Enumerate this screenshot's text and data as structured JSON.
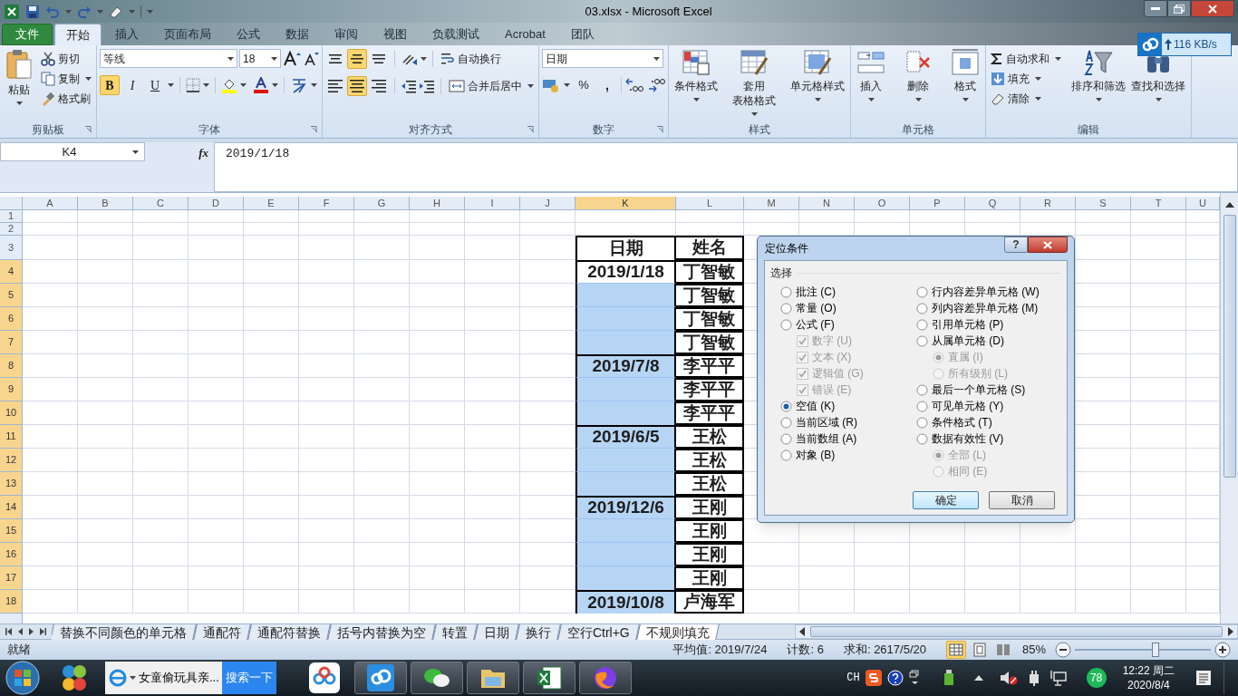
{
  "window": {
    "title": "03.xlsx  -  Microsoft Excel"
  },
  "ribbon_tabs": [
    {
      "label": "文件",
      "kind": "file",
      "selected": false
    },
    {
      "label": "开始",
      "kind": "tab",
      "selected": true
    },
    {
      "label": "插入",
      "kind": "tab",
      "selected": false
    },
    {
      "label": "页面布局",
      "kind": "tab",
      "selected": false
    },
    {
      "label": "公式",
      "kind": "tab",
      "selected": false
    },
    {
      "label": "数据",
      "kind": "tab",
      "selected": false
    },
    {
      "label": "审阅",
      "kind": "tab",
      "selected": false
    },
    {
      "label": "视图",
      "kind": "tab",
      "selected": false
    },
    {
      "label": "负载测试",
      "kind": "tab",
      "selected": false
    },
    {
      "label": "Acrobat",
      "kind": "tab",
      "selected": false
    },
    {
      "label": "团队",
      "kind": "tab",
      "selected": false
    }
  ],
  "upload_widget": {
    "speed": "116 KB/s"
  },
  "ribbon": {
    "clipboard": {
      "title": "剪贴板",
      "paste": "粘贴",
      "cut": "剪切",
      "copy": "复制",
      "format_painter": "格式刷"
    },
    "font": {
      "title": "字体",
      "font_name": "等线",
      "font_size": "18",
      "toggles": [
        {
          "label": "B",
          "on": true
        },
        {
          "label": "I",
          "on": false
        },
        {
          "label": "U",
          "on": false
        }
      ]
    },
    "alignment": {
      "title": "对齐方式",
      "vertical": [
        {
          "on": false
        },
        {
          "on": true
        },
        {
          "on": false
        }
      ],
      "horizontal": [
        {
          "on": false
        },
        {
          "on": true
        },
        {
          "on": false
        }
      ],
      "wrap_text": "自动换行",
      "merge_center": "合并后居中"
    },
    "number": {
      "title": "数字",
      "format": "日期",
      "percent": "%",
      "comma": ","
    },
    "styles": {
      "title": "样式",
      "buttons": [
        {
          "lines": [
            "条件格式"
          ]
        },
        {
          "lines": [
            "套用",
            "表格格式"
          ]
        },
        {
          "lines": [
            "单元格样式"
          ]
        }
      ]
    },
    "cells": {
      "title": "单元格",
      "buttons": [
        {
          "lines": [
            "插入"
          ]
        },
        {
          "lines": [
            "删除"
          ]
        },
        {
          "lines": [
            "格式"
          ]
        }
      ]
    },
    "editing": {
      "title": "编辑",
      "autosum": "自动求和",
      "fill": "填充",
      "clear": "清除",
      "sort_filter": "排序和筛选",
      "find_select": "查找和选择"
    }
  },
  "formula_bar": {
    "name_box": "K4",
    "fx": "fx",
    "value": "2019/1/18"
  },
  "sheet": {
    "columns": [
      {
        "label": "A",
        "selected": false
      },
      {
        "label": "B",
        "selected": false
      },
      {
        "label": "C",
        "selected": false
      },
      {
        "label": "D",
        "selected": false
      },
      {
        "label": "E",
        "selected": false
      },
      {
        "label": "F",
        "selected": false
      },
      {
        "label": "G",
        "selected": false
      },
      {
        "label": "H",
        "selected": false
      },
      {
        "label": "I",
        "selected": false
      },
      {
        "label": "J",
        "selected": false
      },
      {
        "label": "K",
        "selected": true
      },
      {
        "label": "L",
        "selected": false
      },
      {
        "label": "M",
        "selected": false
      },
      {
        "label": "N",
        "selected": false
      },
      {
        "label": "O",
        "selected": false
      },
      {
        "label": "P",
        "selected": false
      },
      {
        "label": "Q",
        "selected": false
      },
      {
        "label": "R",
        "selected": false
      },
      {
        "label": "S",
        "selected": false
      },
      {
        "label": "T",
        "selected": false
      },
      {
        "label": "U",
        "selected": false
      }
    ],
    "rows": [
      {
        "number": "1",
        "selected": false
      },
      {
        "number": "2",
        "selected": false
      },
      {
        "number": "3",
        "selected": false,
        "K": "日期",
        "L": "姓名"
      },
      {
        "number": "4",
        "selected": true,
        "K": "2019/1/18",
        "L": "丁智敏",
        "k_active": true
      },
      {
        "number": "5",
        "selected": true,
        "L": "丁智敏",
        "k_active": false
      },
      {
        "number": "6",
        "selected": true,
        "L": "丁智敏",
        "k_active": false
      },
      {
        "number": "7",
        "selected": true,
        "L": "丁智敏",
        "k_active": false
      },
      {
        "number": "8",
        "selected": true,
        "K": "2019/7/8",
        "L": "李平平",
        "k_active": false
      },
      {
        "number": "9",
        "selected": true,
        "L": "李平平",
        "k_active": false
      },
      {
        "number": "10",
        "selected": true,
        "L": "李平平",
        "k_active": false
      },
      {
        "number": "11",
        "selected": true,
        "K": "2019/6/5",
        "L": "王松",
        "k_active": false
      },
      {
        "number": "12",
        "selected": true,
        "L": "王松",
        "k_active": false
      },
      {
        "number": "13",
        "selected": true,
        "L": "王松",
        "k_active": false
      },
      {
        "number": "14",
        "selected": true,
        "K": "2019/12/6",
        "L": "王刚",
        "k_active": false
      },
      {
        "number": "15",
        "selected": true,
        "L": "王刚",
        "k_active": false
      },
      {
        "number": "16",
        "selected": true,
        "L": "王刚",
        "k_active": false
      },
      {
        "number": "17",
        "selected": true,
        "L": "王刚",
        "k_active": false
      },
      {
        "number": "18",
        "selected": true,
        "K": "2019/10/8",
        "L": "卢海军",
        "k_active": false
      }
    ]
  },
  "dialog": {
    "title": "定位条件",
    "help": "?",
    "group": "选择",
    "left": [
      {
        "label": "批注 (C)",
        "kind": "radio",
        "selected": false,
        "disabled": false
      },
      {
        "label": "常量 (O)",
        "kind": "radio",
        "selected": false,
        "disabled": false
      },
      {
        "label": "公式 (F)",
        "kind": "radio",
        "selected": false,
        "disabled": false,
        "children": [
          {
            "label": "数字 (U)",
            "kind": "checkbox",
            "checked": true,
            "disabled": true
          },
          {
            "label": "文本 (X)",
            "kind": "checkbox",
            "checked": true,
            "disabled": true
          },
          {
            "label": "逻辑值 (G)",
            "kind": "checkbox",
            "checked": true,
            "disabled": true
          },
          {
            "label": "错误 (E)",
            "kind": "checkbox",
            "checked": true,
            "disabled": true
          }
        ]
      },
      {
        "label": "空值 (K)",
        "kind": "radio",
        "selected": true,
        "disabled": false
      },
      {
        "label": "当前区域 (R)",
        "kind": "radio",
        "selected": false,
        "disabled": false
      },
      {
        "label": "当前数组 (A)",
        "kind": "radio",
        "selected": false,
        "disabled": false
      },
      {
        "label": "对象 (B)",
        "kind": "radio",
        "selected": false,
        "disabled": false
      }
    ],
    "right": [
      {
        "label": "行内容差异单元格 (W)",
        "kind": "radio",
        "selected": false,
        "disabled": false
      },
      {
        "label": "列内容差异单元格 (M)",
        "kind": "radio",
        "selected": false,
        "disabled": false
      },
      {
        "label": "引用单元格 (P)",
        "kind": "radio",
        "selected": false,
        "disabled": false
      },
      {
        "label": "从属单元格 (D)",
        "kind": "radio",
        "selected": false,
        "disabled": false,
        "children": [
          {
            "label": "直属 (I)",
            "kind": "radio",
            "selected": true,
            "disabled": true
          },
          {
            "label": "所有级别 (L)",
            "kind": "radio",
            "selected": false,
            "disabled": true
          }
        ]
      },
      {
        "label": "最后一个单元格 (S)",
        "kind": "radio",
        "selected": false,
        "disabled": false
      },
      {
        "label": "可见单元格 (Y)",
        "kind": "radio",
        "selected": false,
        "disabled": false
      },
      {
        "label": "条件格式 (T)",
        "kind": "radio",
        "selected": false,
        "disabled": false
      },
      {
        "label": "数据有效性 (V)",
        "kind": "radio",
        "selected": false,
        "disabled": false,
        "children": [
          {
            "label": "全部 (L)",
            "kind": "radio",
            "selected": true,
            "disabled": true
          },
          {
            "label": "相同 (E)",
            "kind": "radio",
            "selected": false,
            "disabled": true
          }
        ]
      }
    ],
    "buttons": [
      {
        "label": "确定",
        "focused": true
      },
      {
        "label": "取消",
        "focused": false
      }
    ]
  },
  "sheet_tabs": [
    {
      "label": "替换不同颜色的单元格",
      "selected": false
    },
    {
      "label": "通配符",
      "selected": false
    },
    {
      "label": "通配符替换",
      "selected": false
    },
    {
      "label": "括号内替换为空",
      "selected": false
    },
    {
      "label": "转置",
      "selected": false
    },
    {
      "label": "日期",
      "selected": false
    },
    {
      "label": "换行",
      "selected": false
    },
    {
      "label": "空行Ctrl+G",
      "selected": false
    },
    {
      "label": "不规则填充",
      "selected": true
    }
  ],
  "status_bar": {
    "ready": "就绪",
    "average": "平均值: 2019/7/24",
    "count": "计数: 6",
    "sum": "求和: 2617/5/20",
    "views": [
      {
        "selected": true
      },
      {
        "selected": false
      },
      {
        "selected": false
      }
    ],
    "zoom": "85%",
    "zoom_slider": {
      "level": 0.6
    }
  },
  "taskbar": {
    "ie_window": "女童偷玩具亲...",
    "search_button": "搜索一下",
    "tray": {
      "ime": "CH",
      "badge": "78",
      "time": "12:22 周二",
      "date": "2020/8/4"
    }
  }
}
